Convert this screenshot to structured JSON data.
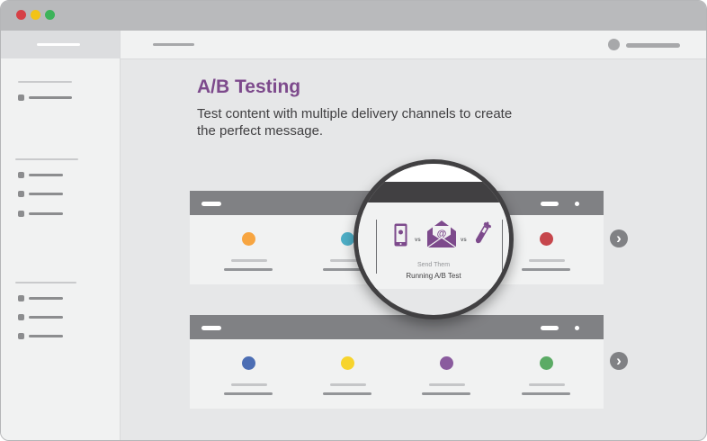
{
  "window": {
    "controls": [
      "close",
      "minimize",
      "maximize"
    ]
  },
  "main": {
    "heading": "A/B Testing",
    "subtitle": "Test content with multiple delivery channels to create the perfect message."
  },
  "magnifier": {
    "icons": [
      "mobile-icon",
      "email-icon",
      "test-tube-icon"
    ],
    "vs_1": "vs",
    "vs_2": "vs",
    "caption_small": "Send Them",
    "caption": "Running A/B Test"
  },
  "panels": [
    {
      "circle_colors": [
        "#f7a541",
        "#4eafc7",
        "#c1c1c1",
        "#c6464c"
      ]
    },
    {
      "circle_colors": [
        "#4c6eb4",
        "#f7d42d",
        "#8a5b9e",
        "#5bab65"
      ]
    }
  ],
  "colors": {
    "accent": "#7d4a8c",
    "heading": "#7d4a8c"
  }
}
